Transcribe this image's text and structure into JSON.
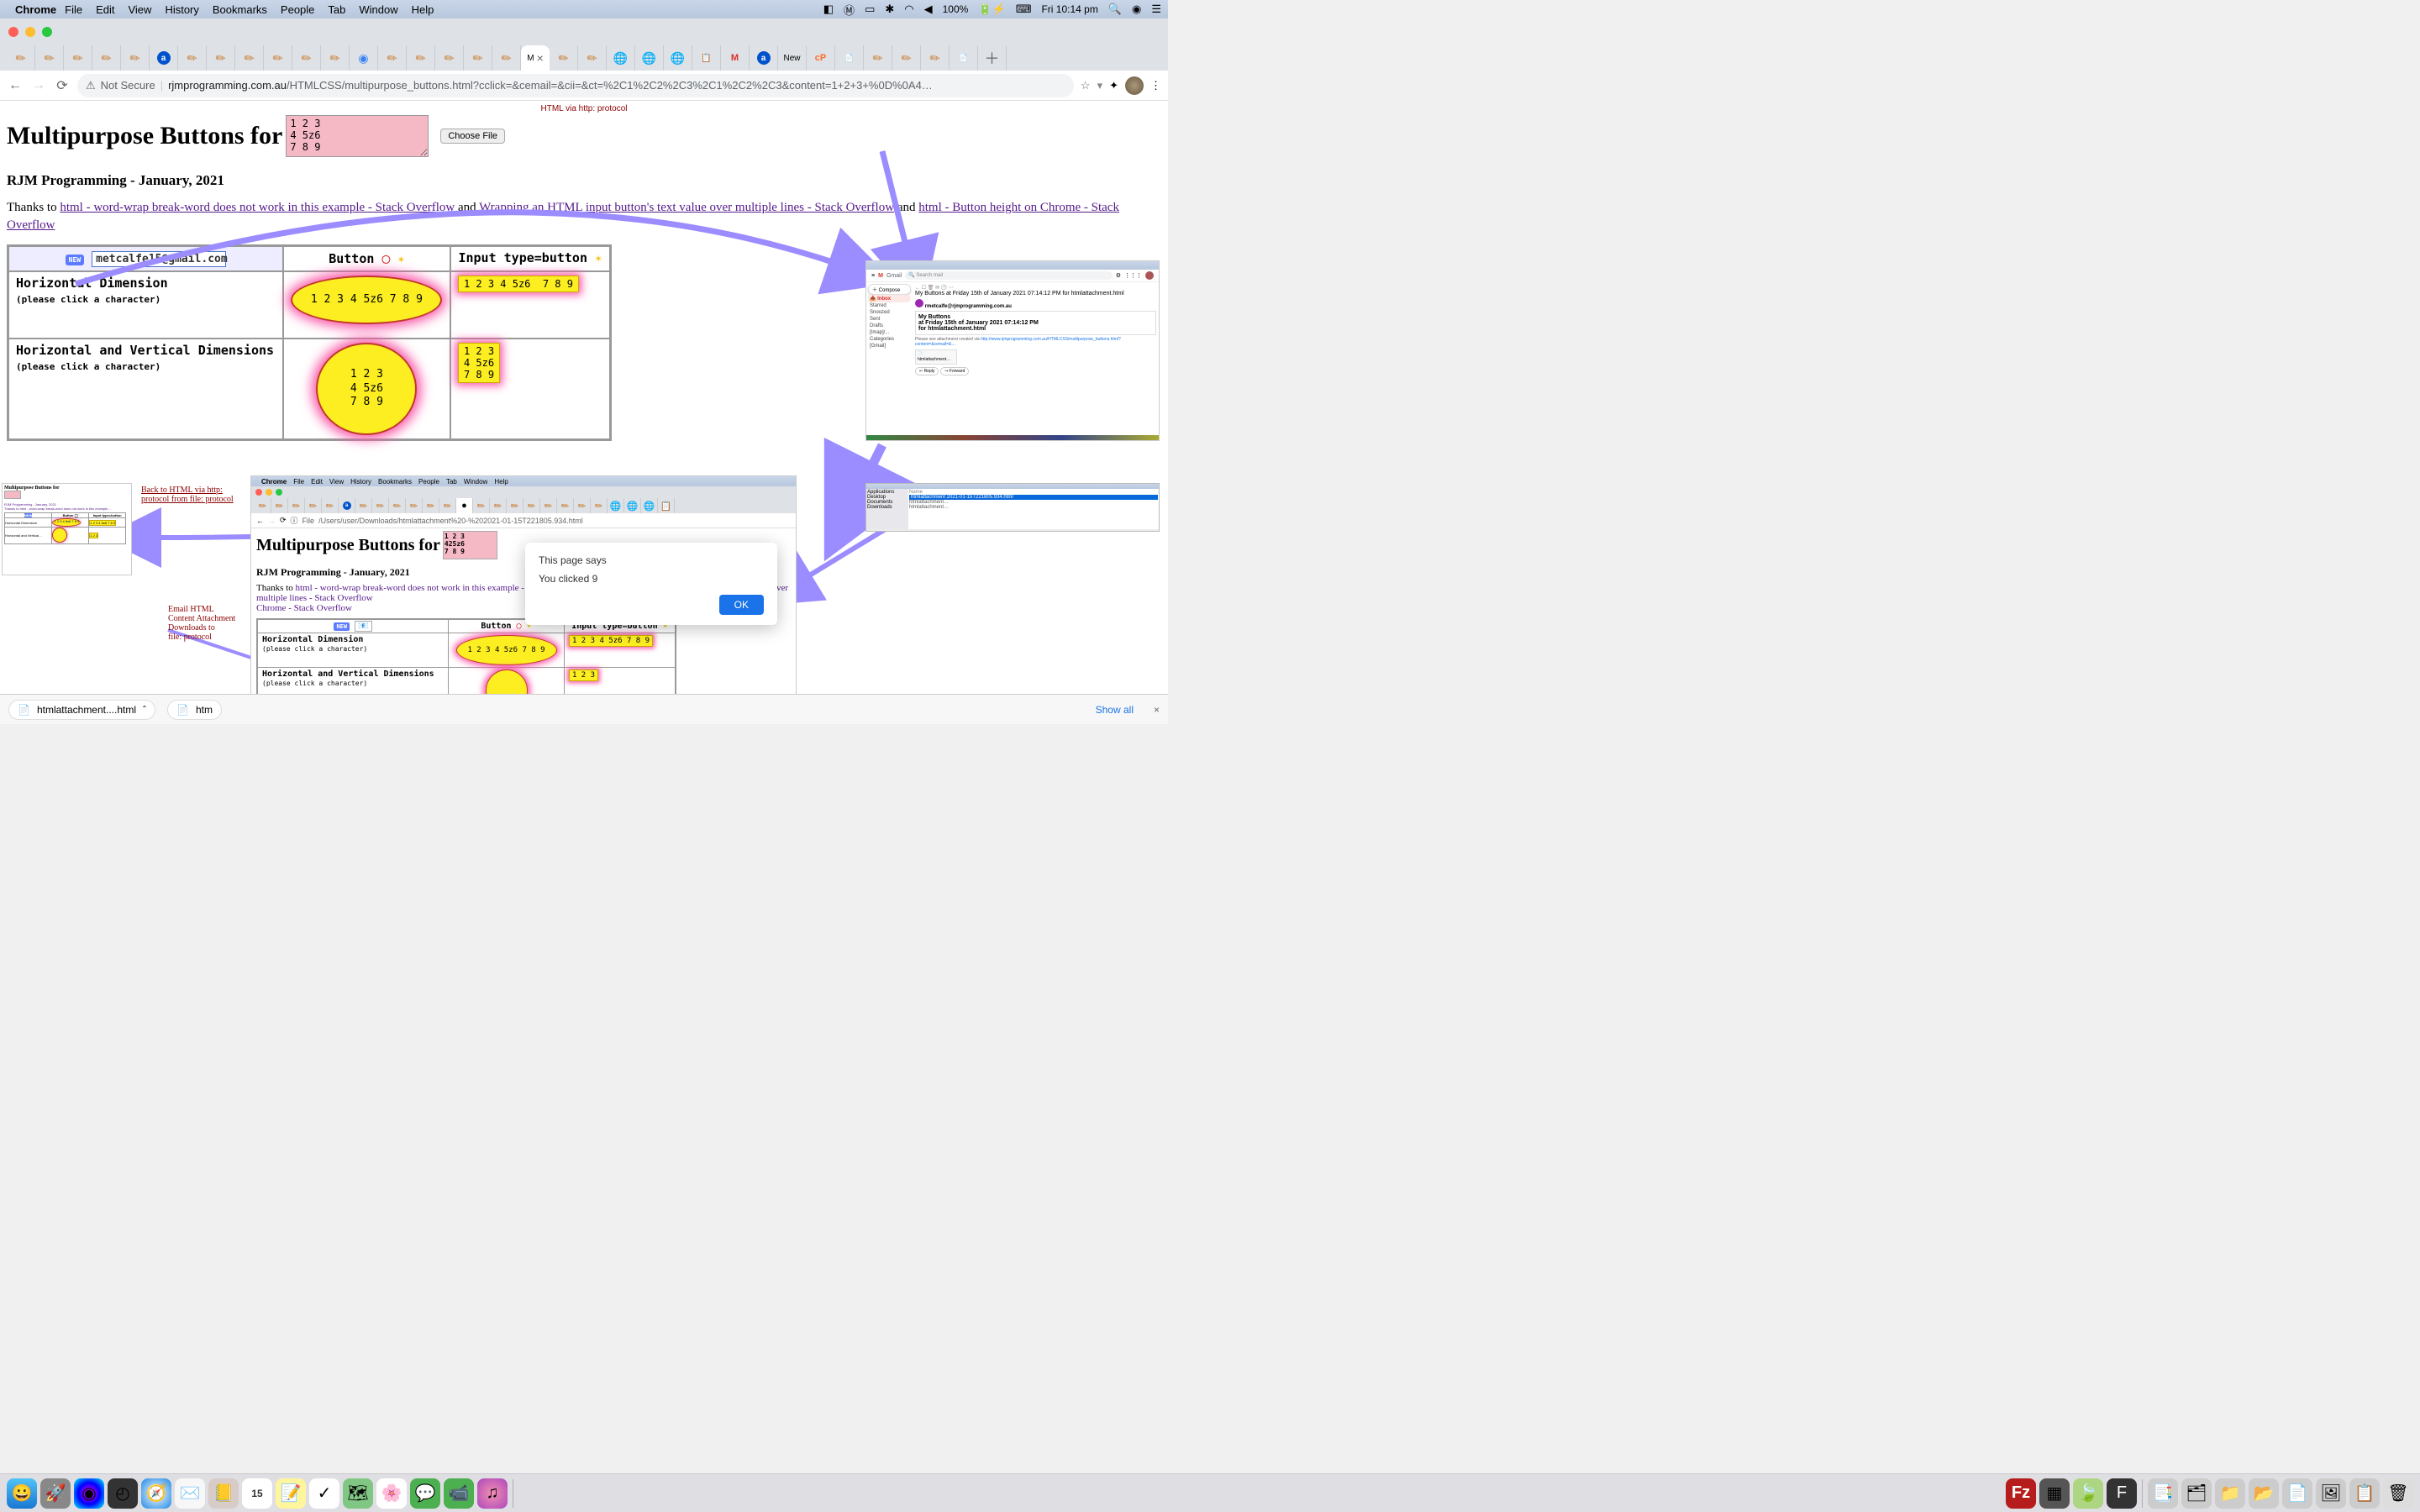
{
  "menubar": {
    "app": "Chrome",
    "items": [
      "File",
      "Edit",
      "View",
      "History",
      "Bookmarks",
      "People",
      "Tab",
      "Window",
      "Help"
    ],
    "right": {
      "battery": "100%",
      "clock": "Fri 10:14 pm"
    }
  },
  "addrbar": {
    "notsecure": "Not Secure",
    "host": "rjmprogramming.com.au",
    "path": "/HTMLCSS/multipurpose_buttons.html?cclick=&cemail=&cii=&ct=%2C1%2C2%2C3%2C1%2C2%2C3&content=1+2+3+%0D%0A4…"
  },
  "page": {
    "httpnote": "HTML via http: protocol",
    "h1": "Multipurpose Buttons for",
    "pink": "1 2 3\n4 5z6\n7 8 9",
    "choosefile": "Choose File",
    "sub": "RJM Programming - January, 2021",
    "thanks_pre": "Thanks to ",
    "link1": "html - word-wrap break-word does not work in this example - Stack Overflow",
    "and1": " and ",
    "link2": "Wrapping an HTML input button's text value over multiple lines - Stack Overflow",
    "and2": " and ",
    "link3": "html - Button height on Chrome - Stack Overflow"
  },
  "table": {
    "new": "NEW",
    "email": "metcalfe15@gmail.com",
    "col_button": "Button",
    "col_input": "Input type=button",
    "row1": {
      "lbl": "Horizontal Dimension",
      "sub": "(please click a character)"
    },
    "row2": {
      "lbl": "Horizontal and Vertical Dimensions",
      "sub": "(please click a character)"
    },
    "oval_h": "1 2 3 4 5z6 7 8 9",
    "oval_hv": "1 2 3\n4 5z6\n7 8 9",
    "sq_h": "1 2 3 4 5z6  7 8 9",
    "sq_hv": "1 2 3\n4 5z6\n7 8 9"
  },
  "gmail": {
    "search": "Search mail",
    "compose": "Compose",
    "inbox": "Inbox",
    "sidebar": [
      "Starred",
      "Snoozed",
      "Sent",
      "Drafts",
      "[Imap]/...",
      "Categories",
      "[Gmail]"
    ],
    "subject": "My Buttons at Friday 15th of January 2021 07:14:12 PM for htmlattachment.html",
    "from": "rmetcalfe@rjmprogramming.com.au",
    "body1": "My Buttons",
    "body2": "at Friday 15th of January 2021 07:14:12 PM",
    "body3": "for htmlattachment.html",
    "att_pre": "Please see attachment created via ",
    "att_url": "http://www.rjmprogramming.com.au/HTMLCSS/multipurpose_buttons.html?content=&cemail=&…",
    "att_file": "htmlattachment…"
  },
  "finder": {
    "selected": "htmlattachment 2021-01-15T221805.934.html",
    "folders": [
      "Applications",
      "Desktop",
      "Documents",
      "Downloads"
    ]
  },
  "mini": {
    "backlink": "Back to HTML via http: protocol from file: protocol",
    "title": "Multipurpose Buttons for"
  },
  "lower": {
    "menubar": {
      "app": "Chrome",
      "items": [
        "File",
        "Edit",
        "View",
        "History",
        "Bookmarks",
        "People",
        "Tab",
        "Window",
        "Help"
      ]
    },
    "file_label": "File",
    "url": "/Users/user/Downloads/htmlattachment%20-%202021-01-15T221805.934.html",
    "h1": "Multipurpose Buttons for",
    "pink": "1 2 3\n425z6\n7 8 9",
    "sub": "RJM Programming - January, 2021",
    "thanks_pre": "Thanks to ",
    "link1": "html - word-wrap break-word does not work in this example - Stack Overflow",
    "and1": " and ",
    "link2": "Wrapping an HTML input button's text value over multiple lines - Stack Overflow",
    "link3": "Chrome - Stack Overflow",
    "col_button": "Button",
    "col_input": "Input type=button",
    "row1_lbl": "Horizontal Dimension",
    "row1_sub": "(please click a character)",
    "row2_lbl": "Horizontal and Vertical Dimensions",
    "row2_sub": "(please click a character)",
    "oval": "1 2 3 4 5z6 7 8 9",
    "sq": "1 2 3 4 5z6  7 8 9",
    "sq2": "1 2 3"
  },
  "alert": {
    "title": "This page says",
    "msg": "You clicked 9",
    "ok": "OK"
  },
  "caption": {
    "email": "Email HTML\nContent Attachment\nDownloads to\nfile: protocol"
  },
  "dlshelf": {
    "item1": "htmlattachment....html",
    "item2": "htm",
    "showall": "Show all"
  },
  "tabs": {
    "active_label": "M",
    "new_label": "New"
  }
}
